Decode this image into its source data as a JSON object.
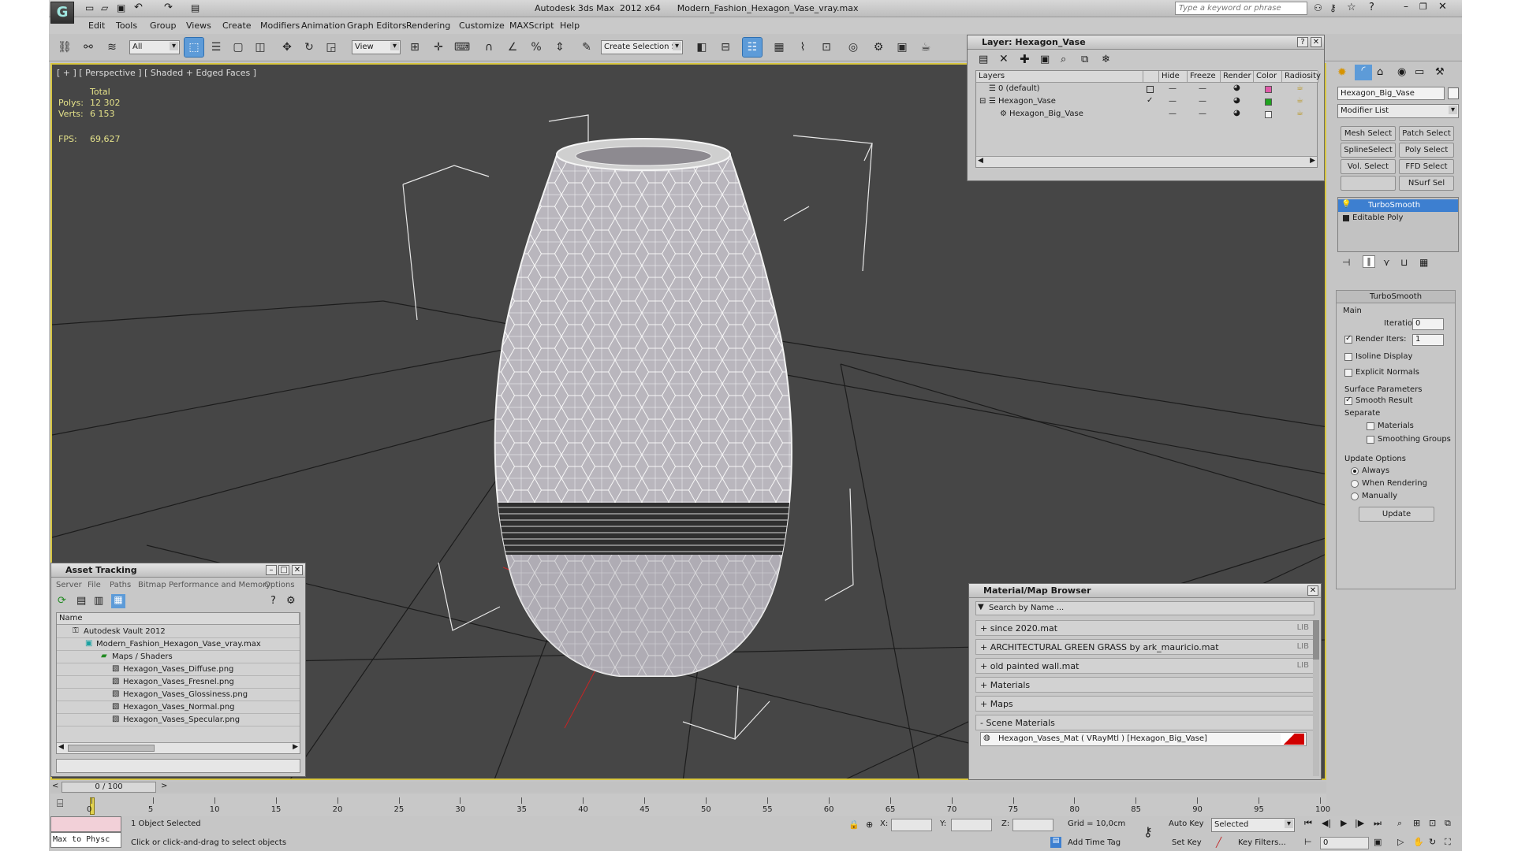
{
  "window": {
    "title": "Autodesk 3ds Max  2012 x64      Modern_Fashion_Hexagon_Vase_vray.max",
    "search_placeholder": "Type a keyword or phrase"
  },
  "menu": [
    "Edit",
    "Tools",
    "Group",
    "Views",
    "Create",
    "Modifiers",
    "Animation",
    "Graph Editors",
    "Rendering",
    "Customize",
    "MAXScript",
    "Help"
  ],
  "toolbar": {
    "filter_value": "All",
    "refcoord_value": "View",
    "selset_placeholder": "Create Selection Se"
  },
  "viewport": {
    "label": "[ + ] [ Perspective ] [ Shaded + Edged Faces ]",
    "stats": {
      "total_label": "Total",
      "polys_label": "Polys:",
      "polys": "12 302",
      "verts_label": "Verts:",
      "verts": "6 153",
      "fps_label": "FPS:",
      "fps": "69,627"
    }
  },
  "layer_panel": {
    "title": "Layer: Hexagon_Vase",
    "columns": [
      "Layers",
      "Hide",
      "Freeze",
      "Render",
      "Color",
      "Radiosity"
    ],
    "rows": [
      {
        "name": "0 (default)",
        "color": "#e05aa8"
      },
      {
        "name": "Hexagon_Vase",
        "color": "#1fa21f"
      },
      {
        "name": "Hexagon_Big_Vase",
        "color": "#f4f4f4"
      }
    ]
  },
  "command_panel": {
    "object_name": "Hexagon_Big_Vase",
    "modifier_list": "Modifier List",
    "modifier_buttons": [
      "Mesh Select",
      "Patch Select",
      "SplineSelect",
      "Poly Select",
      "Vol. Select",
      "FFD Select",
      "",
      "NSurf Sel"
    ],
    "stack": [
      "TurboSmooth",
      "Editable Poly"
    ],
    "rollout_title": "TurboSmooth",
    "main_label": "Main",
    "iterations_label": "Iterations:",
    "iterations_value": "0",
    "render_iters_label": "Render Iters:",
    "render_iters_value": "1",
    "isoline_label": "Isoline Display",
    "explicit_label": "Explicit Normals",
    "surface_label": "Surface Parameters",
    "smooth_label": "Smooth Result",
    "separate_label": "Separate",
    "materials_label": "Materials",
    "smoothing_label": "Smoothing Groups",
    "update_label": "Update Options",
    "always_label": "Always",
    "when_rendering_label": "When Rendering",
    "manually_label": "Manually",
    "update_button": "Update"
  },
  "asset_tracking": {
    "title": "Asset Tracking",
    "menu": [
      "Server",
      "File",
      "Paths",
      "Bitmap Performance and Memory",
      "Options"
    ],
    "name_header": "Name",
    "items": [
      "Autodesk Vault 2012",
      "Modern_Fashion_Hexagon_Vase_vray.max",
      "Maps / Shaders",
      "Hexagon_Vases_Diffuse.png",
      "Hexagon_Vases_Fresnel.png",
      "Hexagon_Vases_Glossiness.png",
      "Hexagon_Vases_Normal.png",
      "Hexagon_Vases_Specular.png"
    ]
  },
  "material_browser": {
    "title": "Material/Map Browser",
    "search_placeholder": "Search by Name ...",
    "categories": [
      {
        "label": "+ since 2020.mat",
        "lib": "LIB"
      },
      {
        "label": "+ ARCHITECTURAL GREEN GRASS by ark_mauricio.mat",
        "lib": "LIB"
      },
      {
        "label": "+ old painted wall.mat",
        "lib": "LIB"
      },
      {
        "label": "+ Materials",
        "lib": ""
      },
      {
        "label": "+ Maps",
        "lib": ""
      },
      {
        "label": "- Scene Materials",
        "lib": ""
      }
    ],
    "scene_material": "Hexagon_Vases_Mat  ( VRayMtl ) [Hexagon_Big_Vase]"
  },
  "timeline": {
    "frame_counter": "0 / 100",
    "ticks": [
      "0",
      "5",
      "10",
      "15",
      "20",
      "25",
      "30",
      "35",
      "40",
      "45",
      "50",
      "55",
      "60",
      "65",
      "70",
      "75",
      "80",
      "85",
      "90",
      "95",
      "100"
    ]
  },
  "status": {
    "maxscript": "Max to Physc",
    "selected": "1 Object Selected",
    "prompt": "Click or click-and-drag to select objects",
    "x_label": "X:",
    "y_label": "Y:",
    "z_label": "Z:",
    "grid": "Grid = 10,0cm",
    "add_time_tag": "Add Time Tag",
    "auto_key": "Auto Key",
    "set_key": "Set Key",
    "key_mode": "Selected",
    "key_filters": "Key Filters...",
    "current_frame": "0"
  }
}
